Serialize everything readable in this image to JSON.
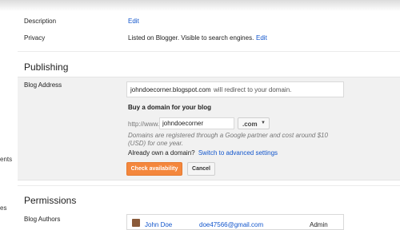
{
  "sidebar_fragments": {
    "item1": "ents",
    "item2": "es"
  },
  "basics": {
    "description_label": "Description",
    "description_action": "Edit",
    "privacy_label": "Privacy",
    "privacy_value": "Listed on Blogger. Visible to search engines.",
    "privacy_action": "Edit"
  },
  "publishing": {
    "title": "Publishing",
    "blog_address_label": "Blog Address",
    "address_value": "johndoecorner.blogspot.com",
    "address_note": "will redirect to your domain.",
    "buy_title": "Buy a domain for your blog",
    "url_prefix": "http://www.",
    "domain_input_value": "johndoecorner",
    "tld_selected": ".com",
    "disclaimer": "Domains are registered through a Google partner and cost around $10 (USD) for one year.",
    "own_domain_text": "Already own a domain?",
    "advanced_link": "Switch to advanced settings",
    "check_button": "Check availability",
    "cancel_button": "Cancel"
  },
  "permissions": {
    "title": "Permissions",
    "blog_authors_label": "Blog Authors",
    "author_name": "John Doe",
    "author_email": "doe47566@gmail.com",
    "author_role": "Admin"
  },
  "colors": {
    "link": "#1155cc",
    "primary_button": "#f4873d",
    "panel_bg": "#f1f1f1"
  }
}
